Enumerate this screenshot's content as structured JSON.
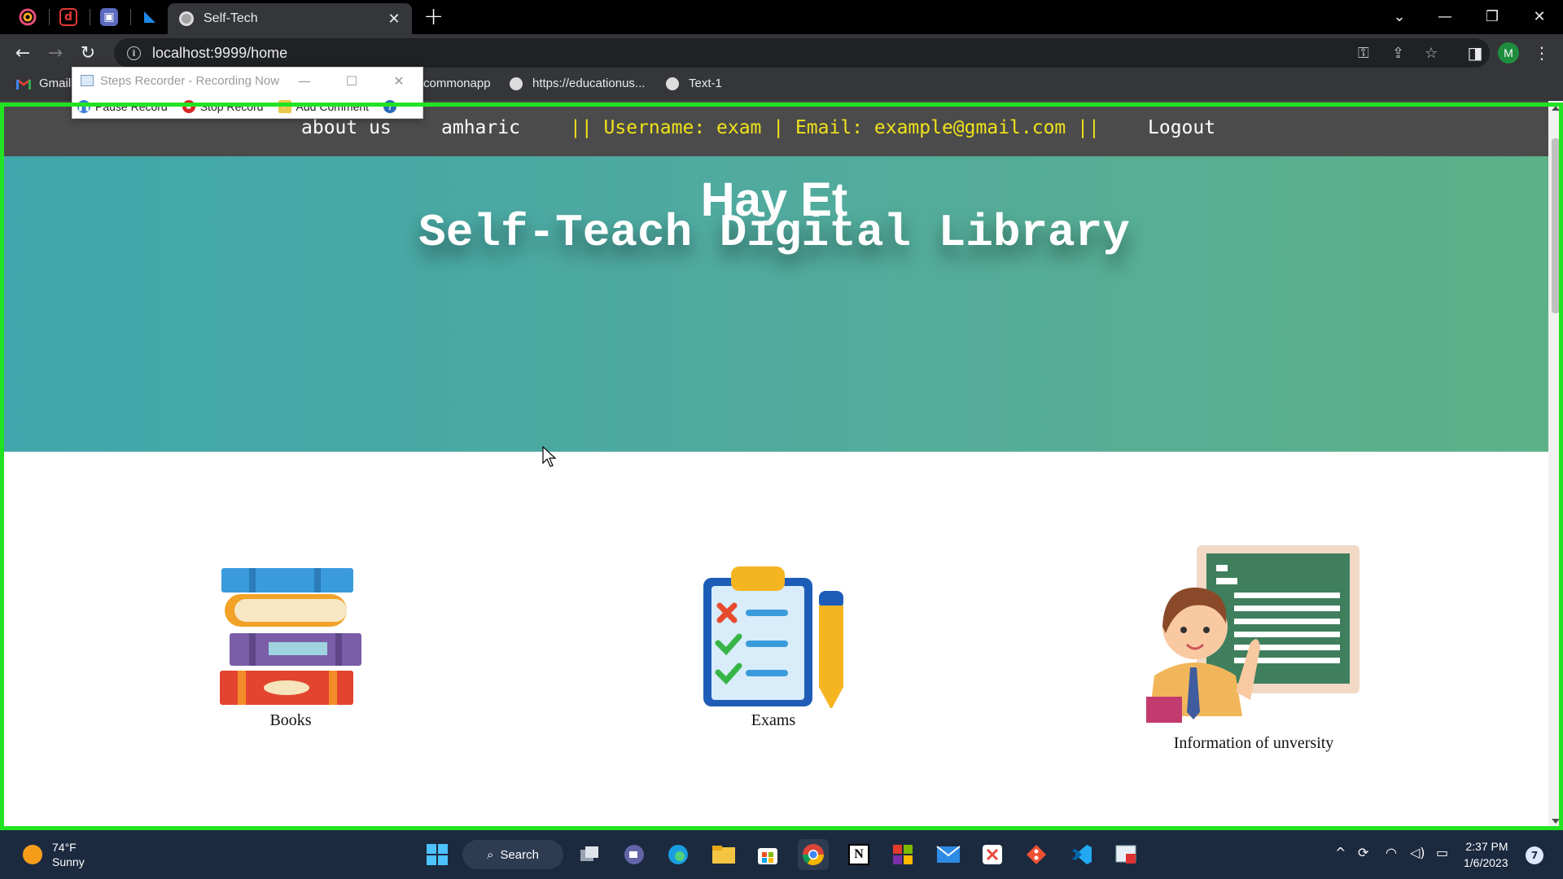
{
  "browser": {
    "tab_title": "Self-Tech",
    "url": "localhost:9999/home",
    "profile_initial": "M",
    "bookmarks": [
      "Gmail",
      "commonapp",
      "https://educationus...",
      "Text-1"
    ]
  },
  "recorder": {
    "title": "Steps Recorder - Recording Now",
    "pause_label": "Pause Record",
    "stop_label": "Stop Record",
    "comment_label": "Add Comment"
  },
  "site": {
    "nav": {
      "about": "about us",
      "amharic": "amharic",
      "user_info": "|| Username: exam | Email: example@gmail.com ||",
      "logout": "Logout"
    },
    "hero": {
      "subtitle": "Hay Et",
      "title": "Self-Teach Digital Library"
    },
    "cards": [
      {
        "label": "Books",
        "icon": "books-icon"
      },
      {
        "label": "Exams",
        "icon": "exam-clipboard-icon"
      },
      {
        "label": "Information of unversity",
        "icon": "teacher-blackboard-icon"
      }
    ]
  },
  "taskbar": {
    "weather_temp": "74°F",
    "weather_desc": "Sunny",
    "search_label": "Search",
    "time": "2:37 PM",
    "date": "1/6/2023",
    "notification_count": "7"
  },
  "colors": {
    "nav_bg": "#4b4b4b",
    "user_info": "#f0e21b",
    "hero_start": "#40a6ab",
    "hero_end": "#5db188",
    "recording_frame": "#22e322"
  }
}
